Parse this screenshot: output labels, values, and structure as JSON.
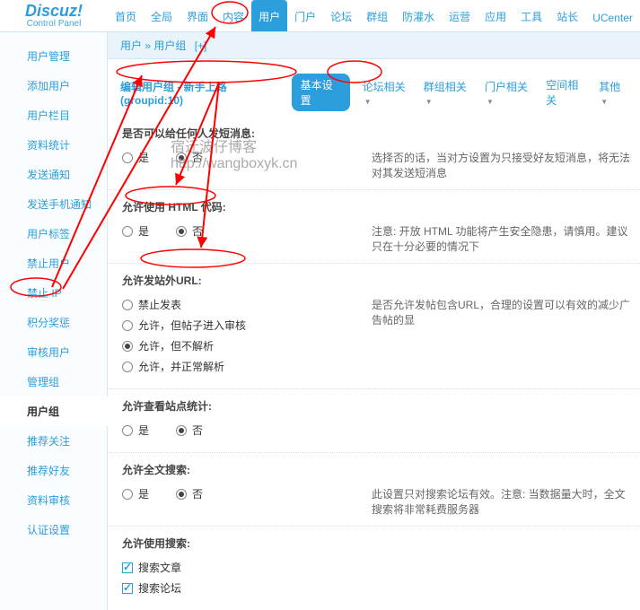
{
  "logo": {
    "main": "Discuz!",
    "sub": "Control Panel"
  },
  "topnav": [
    "首页",
    "全局",
    "界面",
    "内容",
    "用户",
    "门户",
    "论坛",
    "群组",
    "防灌水",
    "运营",
    "应用",
    "工具",
    "站长",
    "UCenter"
  ],
  "topnav_active": 4,
  "sidebar": [
    "用户管理",
    "添加用户",
    "用户栏目",
    "资料统计",
    "发送通知",
    "发送手机通知",
    "用户标签",
    "禁止用户",
    "禁止 IP",
    "积分奖惩",
    "审核用户",
    "管理组",
    "用户组",
    "推荐关注",
    "推荐好友",
    "资料审核",
    "认证设置"
  ],
  "sidebar_active": 12,
  "breadcrumb": {
    "a": "用户",
    "b": "用户组",
    "plus": "[+]"
  },
  "edit": {
    "label": "编辑用户组 - 新手上路(groupid:10)"
  },
  "tabs": {
    "basic": "基本设置",
    "forum": "论坛相关",
    "group": "群组相关",
    "portal": "门户相关",
    "space": "空间相关",
    "other": "其他"
  },
  "sections": {
    "s1": {
      "title": "是否可以给任何人发短消息:",
      "yes": "是",
      "no": "否",
      "help": "选择否的话，当对方设置为只接受好友短消息，将无法对其发送短消息"
    },
    "s2": {
      "title": "允许使用 HTML 代码:",
      "yes": "是",
      "no": "否",
      "help": "注意: 开放 HTML 功能将产生安全隐患，请慎用。建议只在十分必要的情况下"
    },
    "s3": {
      "title": "允许发站外URL:",
      "o1": "禁止发表",
      "o2": "允许，但帖子进入审核",
      "o3": "允许，但不解析",
      "o4": "允许，并正常解析",
      "help": "是否允许发帖包含URL，合理的设置可以有效的减少广告帖的显"
    },
    "s4": {
      "title": "允许查看站点统计:",
      "yes": "是",
      "no": "否"
    },
    "s5": {
      "title": "允许全文搜索:",
      "yes": "是",
      "no": "否",
      "help": "此设置只对搜索论坛有效。注意: 当数据量大时，全文搜索将非常耗费服务器"
    },
    "s6": {
      "title": "允许使用搜索:",
      "c1": "搜索文章",
      "c2": "搜索论坛"
    }
  },
  "watermark": {
    "a": "宿迁波仔博客",
    "b": "http://wangboxyk.cn"
  }
}
